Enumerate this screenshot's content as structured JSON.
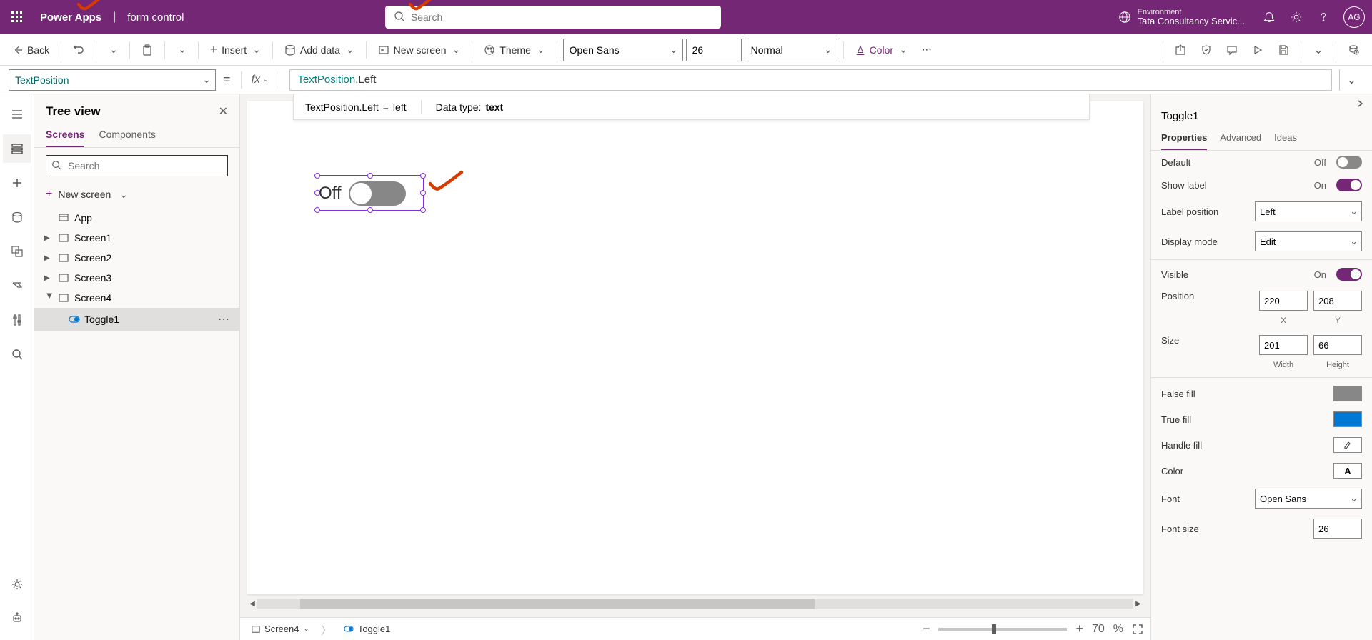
{
  "header": {
    "brand": "Power Apps",
    "docName": "form control",
    "searchPlaceholder": "Search",
    "envLabel": "Environment",
    "envName": "Tata Consultancy Servic...",
    "avatar": "AG"
  },
  "toolbar": {
    "back": "Back",
    "insert": "Insert",
    "addData": "Add data",
    "newScreen": "New screen",
    "theme": "Theme",
    "font": "Open Sans",
    "fontSize": "26",
    "weight": "Normal",
    "color": "Color"
  },
  "formula": {
    "property": "TextPosition",
    "fx": "fx",
    "tokenType": "TextPosition",
    "tokenProp": ".Left",
    "resultExpr": "TextPosition.Left",
    "resultEq": "=",
    "resultVal": "left",
    "dataTypeLabel": "Data type:",
    "dataType": "text"
  },
  "tree": {
    "title": "Tree view",
    "tabs": {
      "screens": "Screens",
      "components": "Components"
    },
    "searchPlaceholder": "Search",
    "newScreen": "New screen",
    "app": "App",
    "s1": "Screen1",
    "s2": "Screen2",
    "s3": "Screen3",
    "s4": "Screen4",
    "toggle": "Toggle1"
  },
  "canvas": {
    "toggleLabel": "Off"
  },
  "status": {
    "crumb1": "Screen4",
    "crumb2": "Toggle1",
    "zoom": "70",
    "zoomUnit": "%"
  },
  "props": {
    "name": "Toggle1",
    "tabs": {
      "properties": "Properties",
      "advanced": "Advanced",
      "ideas": "Ideas"
    },
    "default": {
      "lbl": "Default",
      "val": "Off"
    },
    "showLabel": {
      "lbl": "Show label",
      "val": "On"
    },
    "labelPos": {
      "lbl": "Label position",
      "val": "Left"
    },
    "displayMode": {
      "lbl": "Display mode",
      "val": "Edit"
    },
    "visible": {
      "lbl": "Visible",
      "val": "On"
    },
    "position": {
      "lbl": "Position",
      "x": "220",
      "y": "208",
      "xl": "X",
      "yl": "Y"
    },
    "size": {
      "lbl": "Size",
      "w": "201",
      "h": "66",
      "wl": "Width",
      "hl": "Height"
    },
    "falseFill": {
      "lbl": "False fill",
      "color": "#878787"
    },
    "trueFill": {
      "lbl": "True fill",
      "color": "#0078d4"
    },
    "handleFill": {
      "lbl": "Handle fill"
    },
    "color": {
      "lbl": "Color"
    },
    "font": {
      "lbl": "Font",
      "val": "Open Sans"
    },
    "fontSize": {
      "lbl": "Font size",
      "val": "26"
    }
  }
}
